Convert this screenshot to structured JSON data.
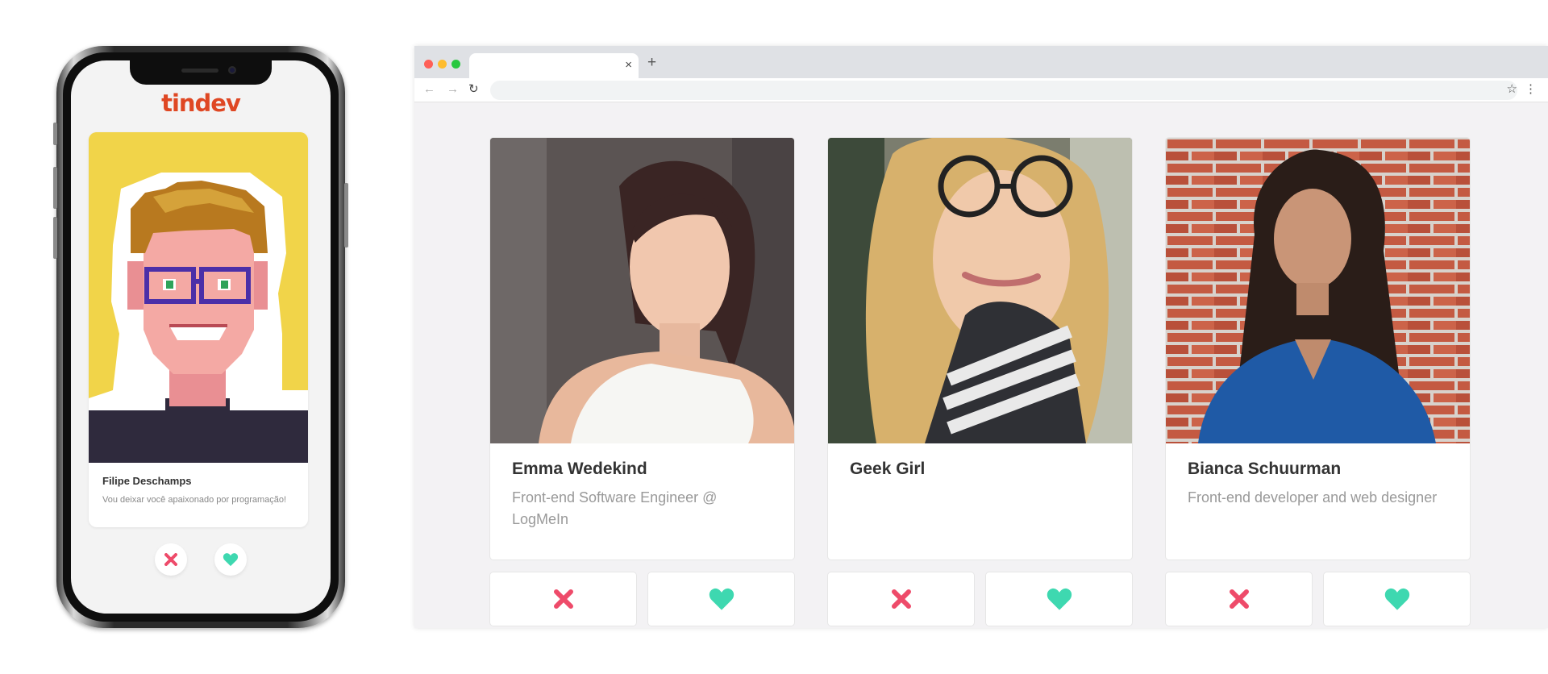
{
  "mobile": {
    "logo": {
      "part1": "tin",
      "part2": "dev"
    },
    "card": {
      "name": "Filipe Deschamps",
      "bio": " Vou deixar você apaixonado por programação!"
    },
    "dislike_icon": "x-icon",
    "like_icon": "heart-icon"
  },
  "browser": {
    "tab_close": "×",
    "new_tab": "+",
    "nav": {
      "back": "←",
      "forward": "→",
      "reload": "↻",
      "bookmark": "☆",
      "menu": "⋮"
    },
    "cards": [
      {
        "name": "Emma Wedekind",
        "bio": "Front-end Software Engineer @ LogMeIn"
      },
      {
        "name": "Geek Girl",
        "bio": ""
      },
      {
        "name": "Bianca Schuurman",
        "bio": "Front-end developer and web designer"
      }
    ]
  },
  "colors": {
    "dislike": "#ee4b6a",
    "like": "#3ed8b0",
    "brand": "#df4723",
    "app_background": "#f3f2f4"
  }
}
